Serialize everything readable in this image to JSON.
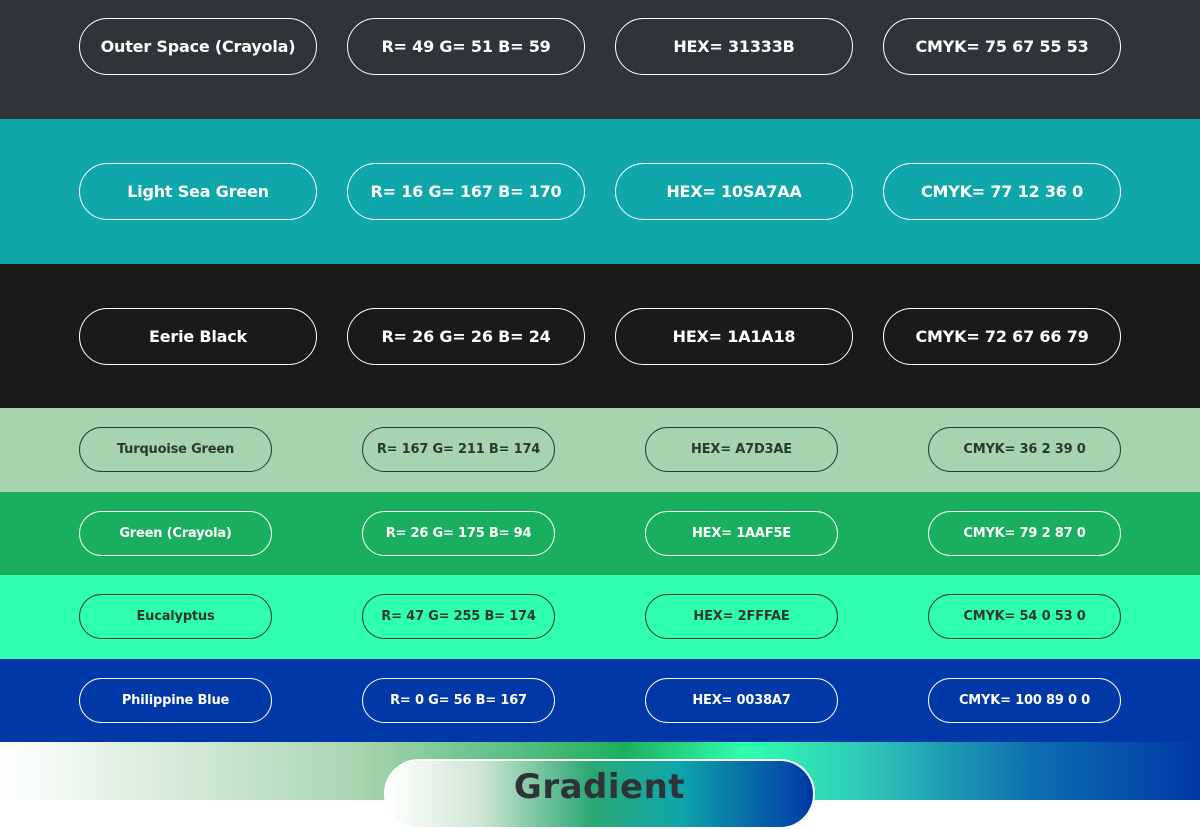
{
  "colors": [
    {
      "name": "Outer Space (Crayola)",
      "rgb": "R= 49 G= 51 B= 59",
      "hex": "HEX= 31333B",
      "cmyk": "CMYK= 75 67 55 53",
      "bg": "#31333B"
    },
    {
      "name": "Light Sea Green",
      "rgb": "R= 16 G= 167 B= 170",
      "hex": "HEX= 10SA7AA",
      "cmyk": "CMYK= 77 12 36 0",
      "bg": "#10A7AA"
    },
    {
      "name": "Eerie Black",
      "rgb": "R= 26 G= 26 B= 24",
      "hex": "HEX= 1A1A18",
      "cmyk": "CMYK= 72 67 66 79",
      "bg": "#1A1A18"
    },
    {
      "name": "Turquoise Green",
      "rgb": "R= 167 G= 211 B= 174",
      "hex": "HEX= A7D3AE",
      "cmyk": "CMYK= 36 2 39 0",
      "bg": "#A7D3AE"
    },
    {
      "name": "Green (Crayola)",
      "rgb": "R= 26 G= 175 B= 94",
      "hex": "HEX= 1AAF5E",
      "cmyk": "CMYK= 79 2 87 0",
      "bg": "#1AAF5E"
    },
    {
      "name": "Eucalyptus",
      "rgb": "R= 47 G= 255 B= 174",
      "hex": "HEX= 2FFFAE",
      "cmyk": "CMYK= 54 0 53 0",
      "bg": "#2FFFAE"
    },
    {
      "name": "Philippine Blue",
      "rgb": "R= 0 G= 56 B= 167",
      "hex": "HEX= 0038A7",
      "cmyk": "CMYK= 100 89 0 0",
      "bg": "#0038A7"
    }
  ],
  "gradient": {
    "label": "Gradient"
  }
}
